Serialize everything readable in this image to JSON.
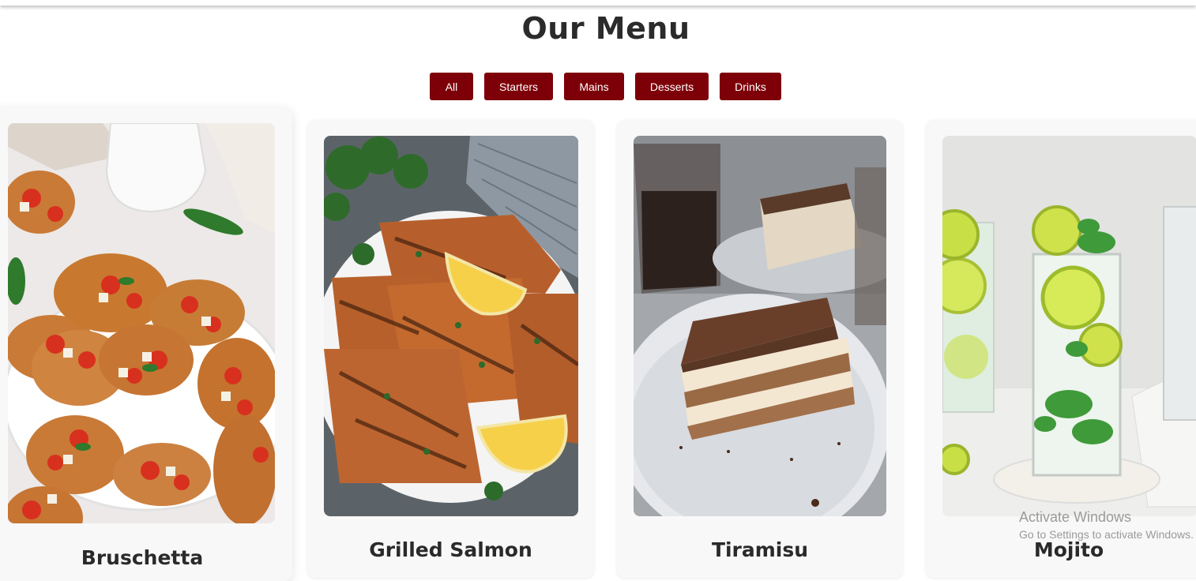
{
  "page": {
    "title": "Our Menu"
  },
  "filters": [
    {
      "label": "All"
    },
    {
      "label": "Starters"
    },
    {
      "label": "Mains"
    },
    {
      "label": "Desserts"
    },
    {
      "label": "Drinks"
    }
  ],
  "menu_items": [
    {
      "name": "Bruschetta"
    },
    {
      "name": "Grilled Salmon"
    },
    {
      "name": "Tiramisu"
    },
    {
      "name": "Mojito"
    }
  ],
  "watermark": {
    "line1": "Activate Windows",
    "line2": "Go to Settings to activate Windows."
  },
  "colors": {
    "accent": "#7d0008",
    "title": "#2b2b2b",
    "card_bg": "#f8f8f8"
  }
}
